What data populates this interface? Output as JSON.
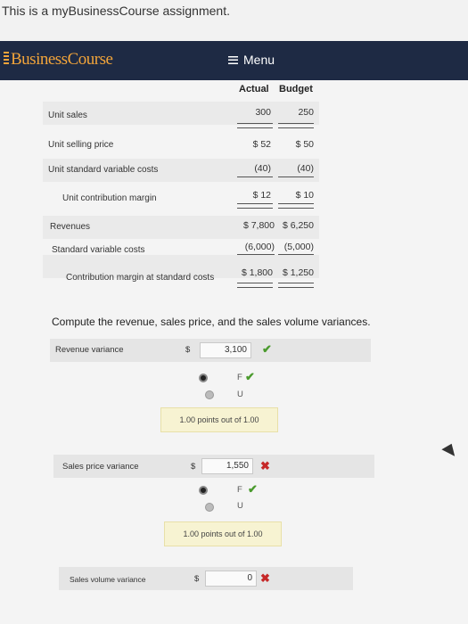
{
  "banner": {
    "text": "This is a myBusinessCourse assignment."
  },
  "nav": {
    "logo": "BusinessCourse",
    "menu_label": "Menu"
  },
  "table": {
    "col_actual": "Actual",
    "col_budget": "Budget",
    "rows": [
      {
        "label": "Unit sales",
        "actual": "300",
        "budget": "250"
      },
      {
        "label": "Unit selling price",
        "actual": "$ 52",
        "budget": "$ 50"
      },
      {
        "label": "Unit standard variable costs",
        "actual": "(40)",
        "budget": "(40)"
      },
      {
        "label": "Unit contribution margin",
        "actual": "$ 12",
        "budget": "$ 10"
      },
      {
        "label": "Revenues",
        "actual": "$ 7,800",
        "budget": "$ 6,250"
      },
      {
        "label": "Standard variable costs",
        "actual": "(6,000)",
        "budget": "(5,000)"
      },
      {
        "label": "Contribution margin at standard costs",
        "actual": "$ 1,800",
        "budget": "$ 1,250"
      }
    ]
  },
  "question": "Compute the revenue, sales price, and the sales volume variances.",
  "answers": {
    "revenue": {
      "label": "Revenue variance",
      "dollar": "$",
      "value": "3,100",
      "fav": "F",
      "unfav": "U",
      "score": "1.00 points out of 1.00"
    },
    "price": {
      "label": "Sales price variance",
      "dollar": "$",
      "value": "1,550",
      "fav": "F",
      "unfav": "U",
      "score": "1.00 points out of 1.00"
    },
    "volume": {
      "label": "Sales volume variance",
      "dollar": "$",
      "value": "0"
    }
  },
  "colors": {
    "nav_bg": "#1e2a44",
    "logo": "#f2a43a",
    "check": "#4a9a2d",
    "cross": "#c62828"
  }
}
